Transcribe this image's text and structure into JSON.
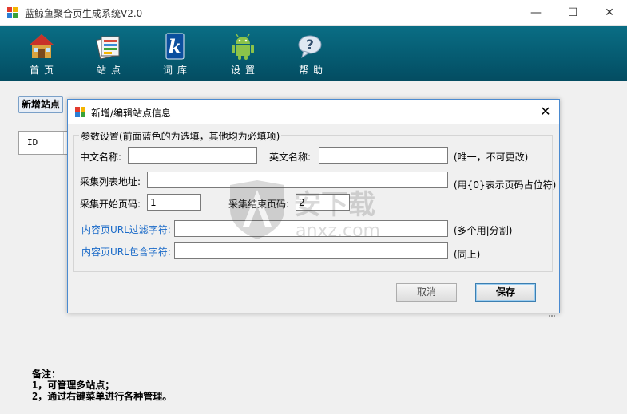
{
  "window": {
    "title": "蓝鲸鱼聚合页生成系统V2.0",
    "min_glyph": "—",
    "max_glyph": "☐",
    "close_glyph": "✕"
  },
  "toolbar": {
    "items": [
      {
        "label": "首页",
        "icon": "home-icon"
      },
      {
        "label": "站点",
        "icon": "sites-icon"
      },
      {
        "label": "词库",
        "icon": "dictionary-icon"
      },
      {
        "label": "设置",
        "icon": "android-settings-icon"
      },
      {
        "label": "帮助",
        "icon": "help-icon"
      }
    ]
  },
  "main": {
    "add_site_label": "新增站点",
    "grid_header_id": "ID",
    "notes": "备注：\n1，可管理多站点；\n2，通过右键菜单进行各种管理。"
  },
  "dialog": {
    "title": "新增/编辑站点信息",
    "close_glyph": "✕",
    "group_title": "参数设置(前面蓝色的为选填，其他均为必填项)",
    "cn_name_label": "中文名称:",
    "cn_name_value": "",
    "en_name_label": "英文名称:",
    "en_name_value": "",
    "en_name_hint": "(唯一，不可更改)",
    "list_url_label": "采集列表地址:",
    "list_url_value": "",
    "list_url_hint": "(用{0}表示页码占位符)",
    "start_page_label": "采集开始页码:",
    "start_page_value": "1",
    "end_page_label": "采集结束页码:",
    "end_page_value": "2",
    "url_filter_label": "内容页URL过滤字符:",
    "url_filter_value": "",
    "url_filter_hint": "(多个用|分割)",
    "url_include_label": "内容页URL包含字符:",
    "url_include_value": "",
    "url_include_hint": "(同上)",
    "cancel_label": "取消",
    "save_label": "保存"
  },
  "watermark": {
    "brand": "安下载",
    "domain": "anxz.com"
  },
  "colors": {
    "toolbar_bg": "#055a70",
    "dialog_border": "#4a8ad0",
    "optional_label": "#1a6ac8"
  }
}
